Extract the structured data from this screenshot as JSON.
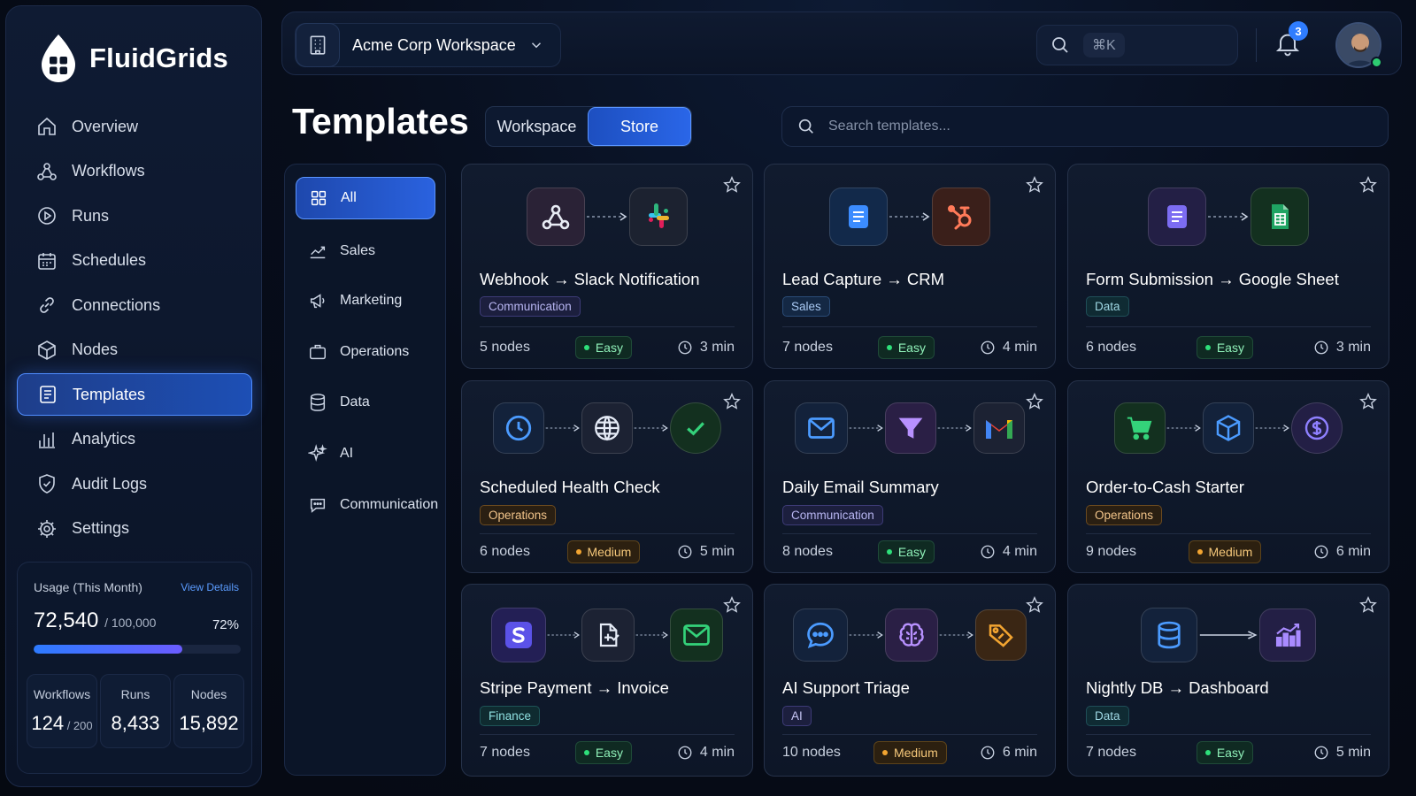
{
  "brand": {
    "name": "FluidGrids"
  },
  "sidebar": {
    "items": [
      {
        "label": "Overview",
        "icon": "home-icon",
        "active": false
      },
      {
        "label": "Workflows",
        "icon": "workflow-icon",
        "active": false
      },
      {
        "label": "Runs",
        "icon": "play-icon",
        "active": false
      },
      {
        "label": "Schedules",
        "icon": "calendar-icon",
        "active": false
      },
      {
        "label": "Connections",
        "icon": "link-icon",
        "active": false
      },
      {
        "label": "Nodes",
        "icon": "cube-icon",
        "active": false
      },
      {
        "label": "Templates",
        "icon": "template-icon",
        "active": true
      },
      {
        "label": "Analytics",
        "icon": "bar-chart-icon",
        "active": false
      },
      {
        "label": "Audit Logs",
        "icon": "shield-icon",
        "active": false
      },
      {
        "label": "Settings",
        "icon": "gear-icon",
        "active": false
      }
    ]
  },
  "usage": {
    "title": "Usage (This Month)",
    "link": "View Details",
    "used": "72,540",
    "limit": "/ 100,000",
    "percent_label": "72%",
    "percent": 0.72,
    "stats": [
      {
        "label": "Workflows",
        "value": "124",
        "suffix": " / 200"
      },
      {
        "label": "Runs",
        "value": "8,433",
        "suffix": ""
      },
      {
        "label": "Nodes",
        "value": "15,892",
        "suffix": ""
      }
    ]
  },
  "topbar": {
    "workspace": "Acme Corp Workspace",
    "shortcut": "⌘K",
    "notifications": "3"
  },
  "page": {
    "title": "Templates",
    "tabs": [
      {
        "label": "Workspace",
        "active": false
      },
      {
        "label": "Store",
        "active": true
      }
    ],
    "search_placeholder": "Search templates..."
  },
  "categories": [
    {
      "label": "All",
      "icon": "grid-icon",
      "active": true
    },
    {
      "label": "Sales",
      "icon": "trend-icon",
      "active": false
    },
    {
      "label": "Marketing",
      "icon": "megaphone-icon",
      "active": false
    },
    {
      "label": "Operations",
      "icon": "briefcase-icon",
      "active": false
    },
    {
      "label": "Data",
      "icon": "database-icon",
      "active": false
    },
    {
      "label": "AI",
      "icon": "sparkle-icon",
      "active": false
    },
    {
      "label": "Communication",
      "icon": "chat-icon",
      "active": false
    }
  ],
  "templates": [
    {
      "title": "Webhook → Slack Notification",
      "tag": "Communication",
      "tag_class": "comm",
      "nodes": "5 nodes",
      "difficulty": "Easy",
      "time": "3 min",
      "icons": [
        "webhook-icon",
        "slack-icon"
      ]
    },
    {
      "title": "Lead Capture → CRM",
      "tag": "Sales",
      "tag_class": "sales",
      "nodes": "7 nodes",
      "difficulty": "Easy",
      "time": "4 min",
      "icons": [
        "form-icon",
        "hubspot-icon"
      ]
    },
    {
      "title": "Form Submission → Google Sheet",
      "tag": "Data",
      "tag_class": "data",
      "nodes": "6 nodes",
      "difficulty": "Easy",
      "time": "3 min",
      "icons": [
        "form-icon",
        "google-sheets-icon"
      ]
    },
    {
      "title": "Scheduled Health Check",
      "tag": "Operations",
      "tag_class": "ops",
      "nodes": "6 nodes",
      "difficulty": "Medium",
      "time": "5 min",
      "icons": [
        "clock-icon",
        "globe-icon",
        "check-icon"
      ]
    },
    {
      "title": "Daily Email Summary",
      "tag": "Communication",
      "tag_class": "comm",
      "nodes": "8 nodes",
      "difficulty": "Easy",
      "time": "4 min",
      "icons": [
        "mail-icon",
        "filter-icon",
        "gmail-icon"
      ]
    },
    {
      "title": "Order-to-Cash Starter",
      "tag": "Operations",
      "tag_class": "ops",
      "nodes": "9 nodes",
      "difficulty": "Medium",
      "time": "6 min",
      "icons": [
        "cart-icon",
        "box-icon",
        "dollar-icon"
      ]
    },
    {
      "title": "Stripe Payment → Invoice",
      "tag": "Finance",
      "tag_class": "fin",
      "nodes": "7 nodes",
      "difficulty": "Easy",
      "time": "4 min",
      "icons": [
        "stripe-icon",
        "document-icon",
        "mail-icon"
      ]
    },
    {
      "title": "AI Support Triage",
      "tag": "AI",
      "tag_class": "ai",
      "nodes": "10 nodes",
      "difficulty": "Medium",
      "time": "6 min",
      "icons": [
        "chat-bubble-icon",
        "brain-icon",
        "tag-icon"
      ]
    },
    {
      "title": "Nightly DB → Dashboard",
      "tag": "Data",
      "tag_class": "data",
      "nodes": "7 nodes",
      "difficulty": "Easy",
      "time": "5 min",
      "icons": [
        "database-icon",
        "chart-icon"
      ]
    }
  ]
}
